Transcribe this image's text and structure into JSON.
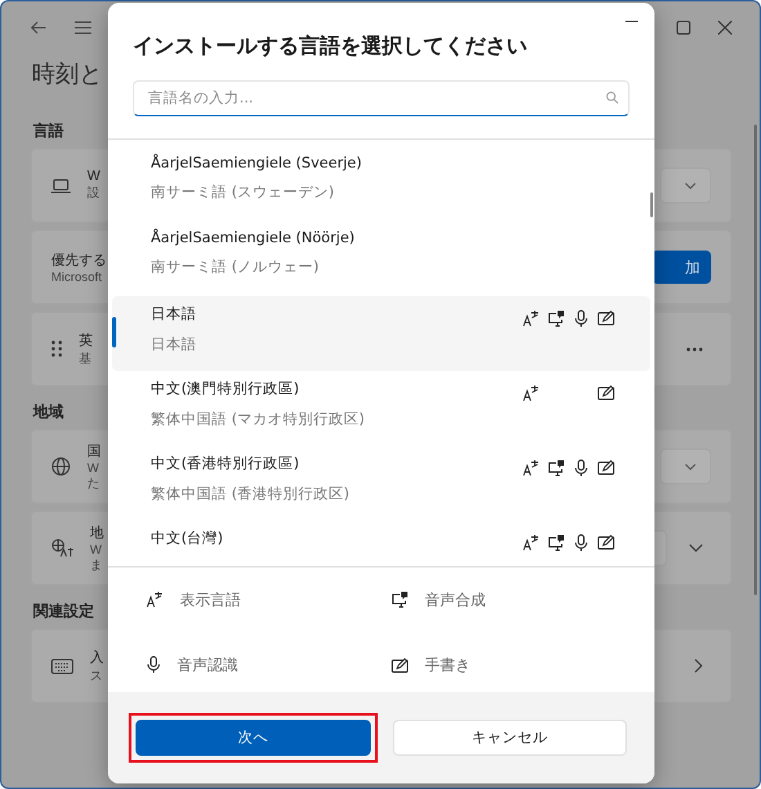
{
  "settings_page": {
    "title": "時刻と",
    "sections": [
      {
        "heading": "言語",
        "cards": [
          {
            "title": "W",
            "lines": [
              "設"
            ],
            "controls": [
              {
                "kind": "dropdown"
              }
            ]
          },
          {
            "title": "優先する",
            "lines": [
              "Microsoft"
            ],
            "controls": [
              {
                "kind": "button",
                "label": "加"
              }
            ]
          },
          {
            "title": "英",
            "lines": [
              "基"
            ],
            "controls": [
              {
                "kind": "more"
              }
            ]
          }
        ]
      },
      {
        "heading": "地域",
        "cards": [
          {
            "title": "国",
            "lines": [
              "W",
              "た"
            ],
            "controls": [
              {
                "kind": "dropdown"
              }
            ]
          },
          {
            "title": "地",
            "lines": [
              "W",
              "ま"
            ],
            "controls": [
              {
                "kind": "dropdown"
              },
              {
                "kind": "expand"
              }
            ]
          }
        ]
      },
      {
        "heading": "関連設定",
        "cards": [
          {
            "title": "入",
            "lines": [
              "ス"
            ],
            "controls": [
              {
                "kind": "chevron"
              }
            ]
          }
        ]
      }
    ]
  },
  "dialog": {
    "title": "インストールする言語を選択してください",
    "search": {
      "placeholder": "言語名の入力..."
    },
    "languages": [
      {
        "name": "ÅarjelSaemiengiele (Sveerje)",
        "native": "南サーミ語 (スウェーデン)",
        "selected": false,
        "display": false,
        "tts": false,
        "speech": false,
        "handwriting": false
      },
      {
        "name": "ÅarjelSaemiengiele (Nöörje)",
        "native": "南サーミ語 (ノルウェー)",
        "selected": false,
        "display": false,
        "tts": false,
        "speech": false,
        "handwriting": false
      },
      {
        "name": "日本語",
        "native": "日本語",
        "selected": true,
        "display": true,
        "tts": true,
        "speech": true,
        "handwriting": true
      },
      {
        "name": "中文(澳門特別行政區)",
        "native": "繁体中国語 (マカオ特別行政区)",
        "selected": false,
        "display": true,
        "tts": false,
        "speech": false,
        "handwriting": true
      },
      {
        "name": "中文(香港特別行政區)",
        "native": "繁体中国語 (香港特別行政区)",
        "selected": false,
        "display": true,
        "tts": true,
        "speech": true,
        "handwriting": true
      },
      {
        "name": "中文(台灣)",
        "selected": false,
        "display": true,
        "tts": true,
        "speech": true,
        "handwriting": true
      }
    ],
    "legend": [
      {
        "kind": "display",
        "label": "表示言語"
      },
      {
        "kind": "tts",
        "label": "音声合成"
      },
      {
        "kind": "speech",
        "label": "音声認識"
      },
      {
        "kind": "handwriting",
        "label": "手書き"
      }
    ],
    "buttons": [
      {
        "label": "次へ",
        "primary": true,
        "highlighted": true
      },
      {
        "label": "キャンセル",
        "primary": false,
        "highlighted": false
      }
    ]
  }
}
